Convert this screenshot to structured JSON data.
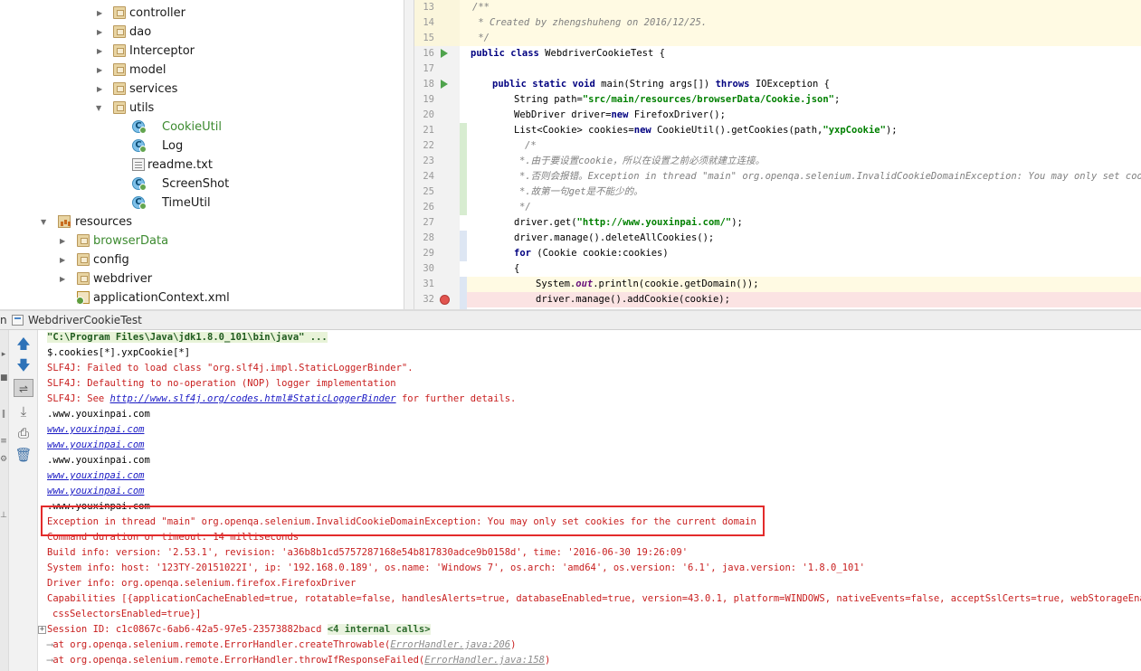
{
  "project_tree": {
    "items": [
      {
        "label": "controller"
      },
      {
        "label": "dao"
      },
      {
        "label": "Interceptor"
      },
      {
        "label": "model"
      },
      {
        "label": "services"
      },
      {
        "label": "utils"
      },
      {
        "label": "CookieUtil"
      },
      {
        "label": "Log"
      },
      {
        "label": "readme.txt"
      },
      {
        "label": "ScreenShot"
      },
      {
        "label": "TimeUtil"
      },
      {
        "label": "resources"
      },
      {
        "label": "browserData"
      },
      {
        "label": "config"
      },
      {
        "label": "webdriver"
      },
      {
        "label": "applicationContext.xml"
      }
    ]
  },
  "editor": {
    "line_numbers": [
      "13",
      "14",
      "15",
      "16",
      "17",
      "18",
      "19",
      "20",
      "21",
      "22",
      "23",
      "24",
      "25",
      "26",
      "27",
      "28",
      "29",
      "30",
      "31",
      "32"
    ],
    "code": {
      "l13": "/**",
      "l14": " * Created by zhengshuheng on 2016/12/25.",
      "l15": " */",
      "l16_k": "public class",
      "l16_t": " WebdriverCookieTest {",
      "l18_k1": "public static void",
      "l18_t1": " main(String args[]) ",
      "l18_k2": "throws",
      "l18_t2": " IOException {",
      "l19_t": "String path=",
      "l19_s": "\"src/main/resources/browserData/Cookie.json\"",
      "l19_e": ";",
      "l20_t1": "WebDriver driver=",
      "l20_k": "new",
      "l20_t2": " FirefoxDriver();",
      "l21_t1": "List<Cookie> cookies=",
      "l21_k": "new",
      "l21_t2": " CookieUtil().getCookies(path,",
      "l21_s": "\"yxpCookie\"",
      "l21_e": ");",
      "l22": "/*",
      "l23": "*.由于要设置cookie，所以在设置之前必须就建立连接。",
      "l24": "*.否则会报错。Exception in thread \"main\" org.openqa.selenium.InvalidCookieDomainException: You may only set cookies",
      "l25": "*.故第一句get是不能少的。",
      "l26": "*/",
      "l27_t": "driver.get(",
      "l27_s": "\"http://www.youxinpai.com/\"",
      "l27_e": ");",
      "l28": "driver.manage().deleteAllCookies();",
      "l29_k": "for",
      "l29_t": " (Cookie cookie:cookies)",
      "l30": "{",
      "l31_t1": "System.",
      "l31_f": "out",
      "l31_t2": ".println(cookie.getDomain());",
      "l32": "driver.manage().addCookie(cookie);"
    }
  },
  "run_panel": {
    "tab_prefix": "n",
    "tab_label": "WebdriverCookieTest",
    "console": {
      "cmd": "\"C:\\Program Files\\Java\\jdk1.8.0_101\\bin\\java\" ...",
      "l2": "$.cookies[*].yxpCookie[*]",
      "l3": "SLF4J: Failed to load class \"org.slf4j.impl.StaticLoggerBinder\".",
      "l4": "SLF4J: Defaulting to no-operation (NOP) logger implementation",
      "l5_pre": "SLF4J: See ",
      "l5_link": "http://www.slf4j.org/codes.html#StaticLoggerBinder",
      "l5_post": " for further details.",
      "l6": ".www.youxinpai.com",
      "l7": "www.youxinpai.com",
      "l8": "www.youxinpai.com",
      "l9": ".www.youxinpai.com",
      "l10": "www.youxinpai.com",
      "l11": "www.youxinpai.com",
      "l12": ".www.youxinpai.com",
      "l13": "Exception in thread \"main\" org.openqa.selenium.InvalidCookieDomainException: You may only set cookies for the current domain",
      "l14": "Command duration or timeout: 14 milliseconds",
      "l15": "Build info: version: '2.53.1', revision: 'a36b8b1cd5757287168e54b817830adce9b0158d', time: '2016-06-30 19:26:09'",
      "l16": "System info: host: '123TY-20151022I', ip: '192.168.0.189', os.name: 'Windows 7', os.arch: 'amd64', os.version: '6.1', java.version: '1.8.0_101'",
      "l17": "Driver info: org.openqa.selenium.firefox.FirefoxDriver",
      "l18": "Capabilities [{applicationCacheEnabled=true, rotatable=false, handlesAlerts=true, databaseEnabled=true, version=43.0.1, platform=WINDOWS, nativeEvents=false, acceptSslCerts=true, webStorageEnabled=true,",
      "l19": "cssSelectorsEnabled=true}]",
      "l20_pre": "Session ID: c1c0867c-6ab6-42a5-97e5-23573882bacd ",
      "l20_int": "<4 internal calls>",
      "l21_pre": "at org.openqa.selenium.remote.ErrorHandler.createThrowable(",
      "l21_link": "ErrorHandler.java:206",
      "l21_post": ")",
      "l22_pre": "at org.openqa.selenium.remote.ErrorHandler.throwIfResponseFailed(",
      "l22_link": "ErrorHandler.java:158",
      "l22_post": ")"
    }
  }
}
